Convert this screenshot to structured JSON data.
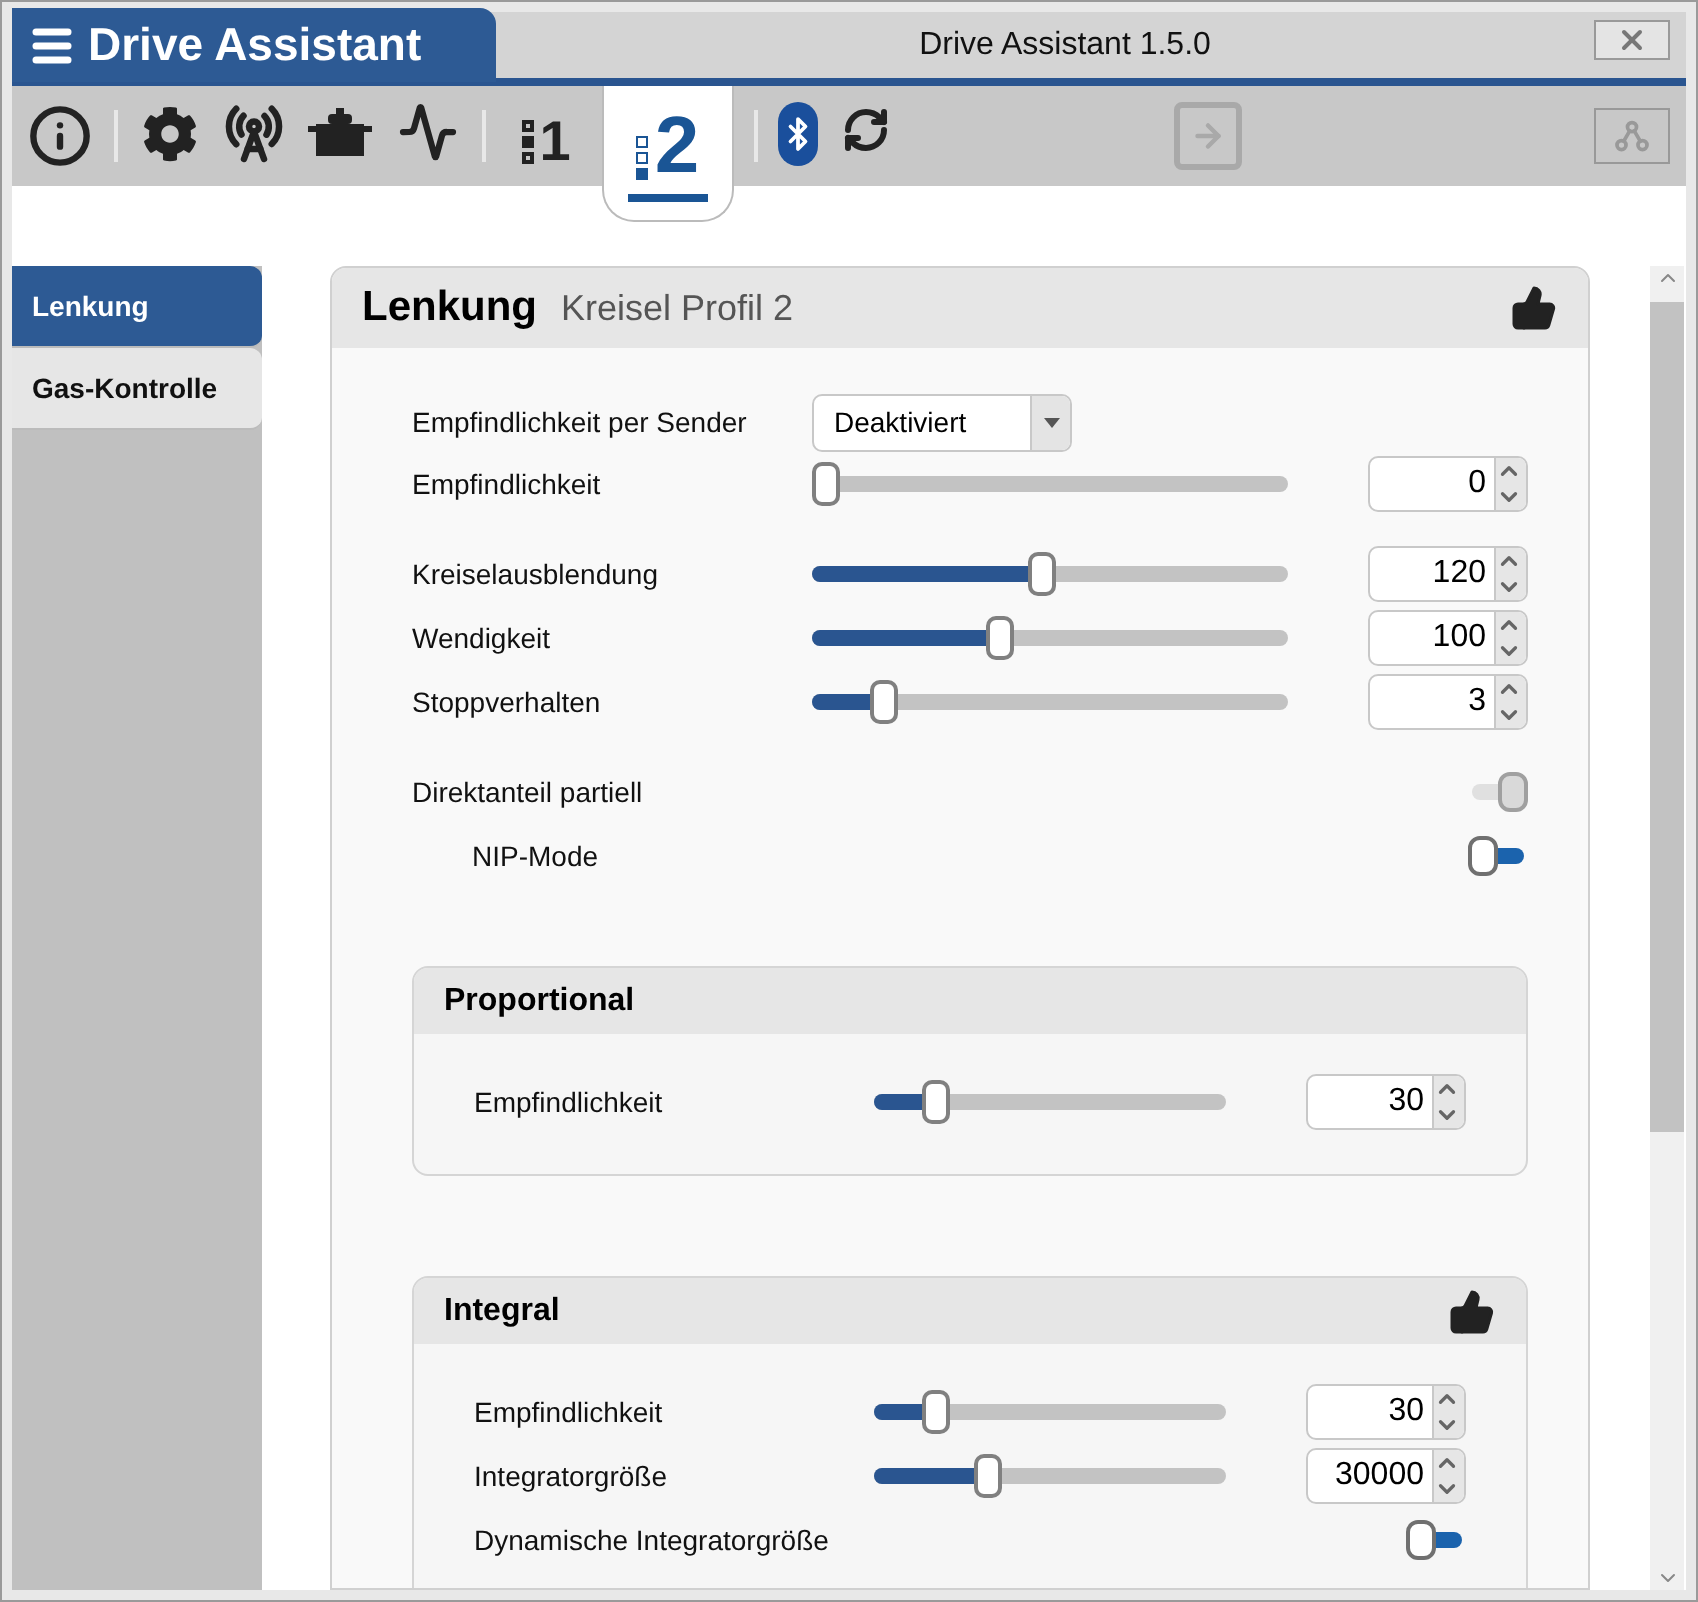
{
  "window": {
    "app_name": "Drive Assistant",
    "title": "Drive Assistant 1.5.0"
  },
  "toolbar": [
    {
      "kind": "info"
    },
    {
      "kind": "settings"
    },
    {
      "kind": "antenna"
    },
    {
      "kind": "servo"
    },
    {
      "kind": "chart"
    },
    {
      "kind": "profile",
      "label": "1",
      "selected": false
    },
    {
      "kind": "profile",
      "label": "2",
      "selected": true
    },
    {
      "kind": "bluetooth"
    },
    {
      "kind": "refresh"
    },
    {
      "kind": "import",
      "disabled": true
    },
    {
      "kind": "connection",
      "disabled": true
    }
  ],
  "sidebar": {
    "items": [
      {
        "label": "Lenkung",
        "selected": true
      },
      {
        "label": "Gas-Kontrolle",
        "selected": false
      }
    ]
  },
  "panel": {
    "title": "Lenkung",
    "subtitle": "Kreisel Profil 2",
    "thumbs_up": true,
    "row_groups": [
      [
        {
          "kind": "dropdown",
          "label": "Empfindlichkeit per Sender",
          "value": "Deaktiviert"
        },
        {
          "kind": "slider",
          "label": "Empfindlichkeit",
          "level": 0,
          "value": "0"
        }
      ],
      [
        {
          "kind": "slider",
          "label": "Kreiselausblendung",
          "level": 0.48,
          "value": "120"
        },
        {
          "kind": "slider",
          "label": "Wendigkeit",
          "level": 0.39,
          "value": "100"
        },
        {
          "kind": "slider",
          "label": "Stoppverhalten",
          "level": 0.13,
          "value": "3"
        }
      ],
      [
        {
          "kind": "toggle",
          "label": "Direktanteil partiell",
          "on": true,
          "disabled": true,
          "children": [
            {
              "kind": "toggle",
              "label": "NIP-Mode",
              "on": false,
              "disabled": false
            }
          ]
        }
      ]
    ],
    "groups": [
      {
        "title": "Proportional",
        "thumbs_up": false,
        "rows": [
          {
            "kind": "slider",
            "label": "Empfindlichkeit",
            "level": 0.15,
            "value": "30"
          }
        ]
      },
      {
        "title": "Integral",
        "thumbs_up": true,
        "rows": [
          {
            "kind": "slider",
            "label": "Empfindlichkeit",
            "level": 0.15,
            "value": "30"
          },
          {
            "kind": "slider",
            "label": "Integratorgröße",
            "level": 0.31,
            "value": "30000"
          },
          {
            "kind": "toggle",
            "label": "Dynamische Integratorgröße",
            "on": false,
            "disabled": false
          }
        ]
      }
    ]
  }
}
